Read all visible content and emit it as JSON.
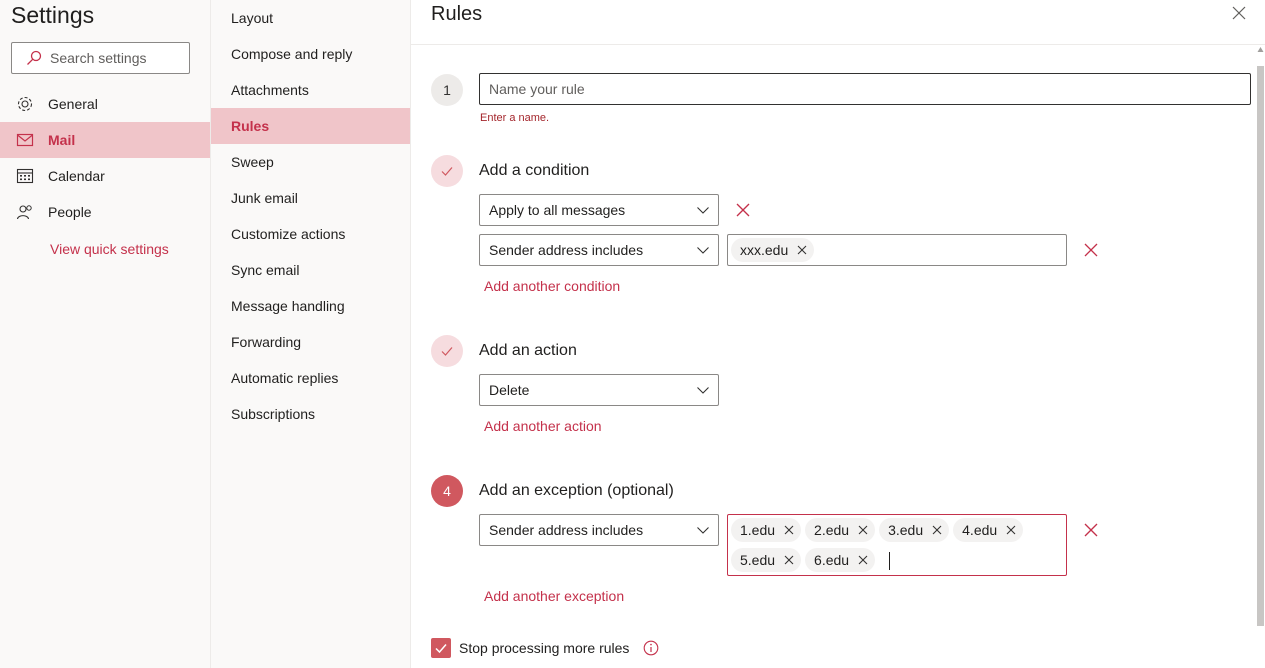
{
  "sidebar": {
    "title": "Settings",
    "search_placeholder": "Search settings",
    "items": [
      {
        "label": "General",
        "icon": "gear-icon"
      },
      {
        "label": "Mail",
        "icon": "mail-icon"
      },
      {
        "label": "Calendar",
        "icon": "calendar-icon"
      },
      {
        "label": "People",
        "icon": "people-icon"
      }
    ],
    "quick_settings": "View quick settings"
  },
  "mail_nav": {
    "items": [
      "Layout",
      "Compose and reply",
      "Attachments",
      "Rules",
      "Sweep",
      "Junk email",
      "Customize actions",
      "Sync email",
      "Message handling",
      "Forwarding",
      "Automatic replies",
      "Subscriptions"
    ],
    "active": "Rules"
  },
  "rules": {
    "title": "Rules",
    "step1": {
      "number": "1",
      "placeholder": "Name your rule",
      "error": "Enter a name."
    },
    "condition": {
      "label": "Add a condition",
      "dropdown1": "Apply to all messages",
      "dropdown2": "Sender address includes",
      "tags": [
        "xxx.edu"
      ],
      "add_link": "Add another condition"
    },
    "action": {
      "label": "Add an action",
      "dropdown": "Delete",
      "add_link": "Add another action"
    },
    "exception": {
      "number": "4",
      "label": "Add an exception (optional)",
      "dropdown": "Sender address includes",
      "tags": [
        "1.edu",
        "2.edu",
        "3.edu",
        "4.edu",
        "5.edu",
        "6.edu"
      ],
      "add_link": "Add another exception"
    },
    "stop_processing": {
      "label": "Stop processing more rules",
      "checked": true
    }
  },
  "colors": {
    "accent": "#c4314b",
    "active_bg": "#f0c5c9",
    "step_red": "#d0585f"
  }
}
